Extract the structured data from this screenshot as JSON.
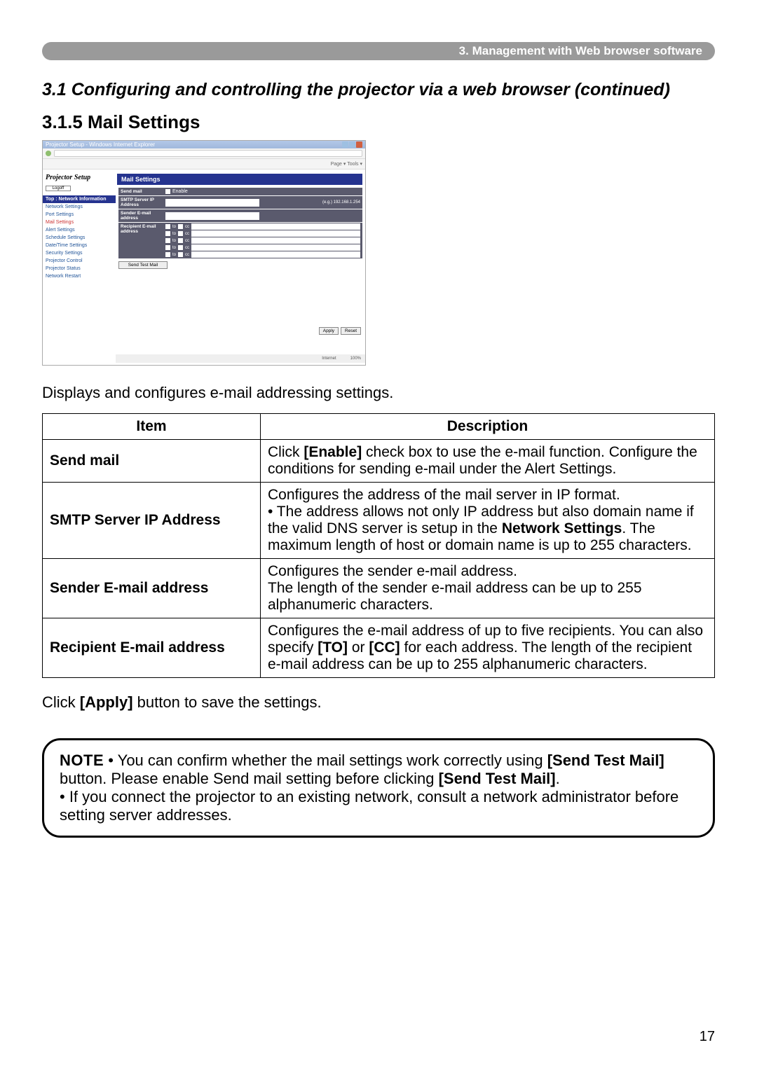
{
  "breadcrumb": "3. Management with Web browser software",
  "section_title": "3.1 Configuring and controlling the projector via a web browser (continued)",
  "subsection_title": "3.1.5 Mail Settings",
  "screenshot": {
    "window_title": "Projector Setup - Windows Internet Explorer",
    "toolbar2_right": "Page ▾  Tools ▾",
    "projector_setup": "Projector Setup",
    "logoff": "Logoff",
    "nav_header": "Top : Network Information",
    "nav_items": [
      "Network Settings",
      "Port Settings",
      "Mail Settings",
      "Alert Settings",
      "Schedule Settings",
      "Date/Time Settings",
      "Security Settings",
      "Projector Control",
      "Projector Status",
      "Network Restart"
    ],
    "active_index": 2,
    "panel_title": "Mail Settings",
    "rows": {
      "send_mail": "Send mail",
      "enable": "Enable",
      "smtp": "SMTP Server IP Address",
      "smtp_eg": "(e.g.) 192.168.1.254",
      "sender": "Sender E-mail address",
      "recipient": "Recipient E-mail address",
      "to": "to",
      "cc": "cc"
    },
    "send_test": "Send Test Mail",
    "apply": "Apply",
    "reset": "Reset",
    "status_internet": "Internet",
    "status_zoom": "100%"
  },
  "intro_text": "Displays and configures e-mail addressing settings.",
  "table": {
    "head_item": "Item",
    "head_desc": "Description",
    "rows": [
      {
        "item": "Send mail",
        "desc_html": "Click <b>[Enable]</b> check box to use the e-mail function. Configure the conditions for sending e-mail under the Alert Settings."
      },
      {
        "item": "SMTP Server IP Address",
        "desc_html": "Configures the address of the mail server in IP format.<br>• The address allows not only IP address but also domain name if the valid DNS server is setup in the <b>Network Settings</b>. The maximum length of host or domain name is up to 255 characters."
      },
      {
        "item": "Sender E-mail address",
        "desc_html": "Configures the sender e-mail address.<br>The length of the sender e-mail address can be up to 255 alphanumeric characters."
      },
      {
        "item": "Recipient E-mail address",
        "desc_html": "Configures the e-mail address of up to five recipients. You can also specify <b>[TO]</b> or <b>[CC]</b> for each address. The length of the recipient e-mail address can be up to 255 alphanumeric characters."
      }
    ]
  },
  "after_table_html": "Click <b>[Apply]</b> button to save the settings.",
  "note": {
    "label": "NOTE",
    "body_html": "• You can confirm whether the mail settings work correctly using <b>[Send Test Mail]</b> button. Please enable Send mail setting before clicking <b>[Send Test Mail]</b>.<br>• If you connect the projector to an existing network, consult a network administrator before setting server addresses."
  },
  "page_number": "17"
}
